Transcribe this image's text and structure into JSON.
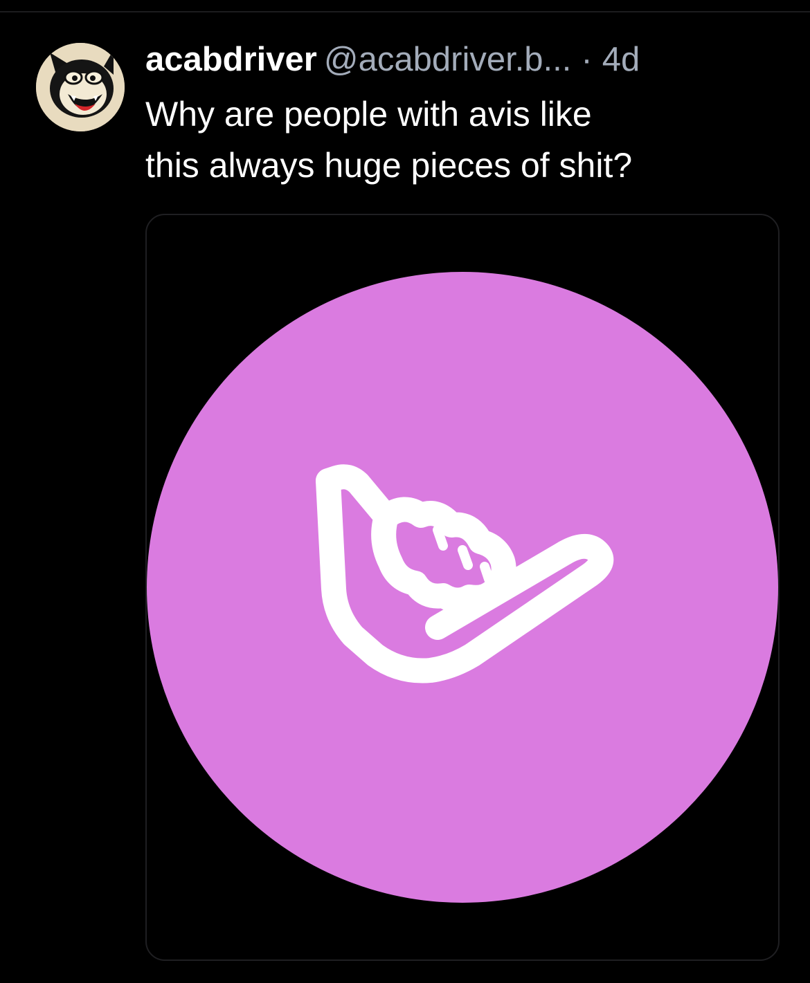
{
  "post": {
    "author": {
      "display_name": "acabdriver",
      "handle": "@acabdriver.b...",
      "avatar_icon": "cartoon-cat-avatar-icon"
    },
    "separator": "·",
    "time_ago": "4d",
    "text_lines": [
      "Why are people with avis like",
      "this always huge pieces of shit?"
    ],
    "media": {
      "icon": "shaka-hand-icon",
      "circle_color": "#da7be0",
      "glyph_color": "#ffffff",
      "background_color": "#000000"
    }
  }
}
